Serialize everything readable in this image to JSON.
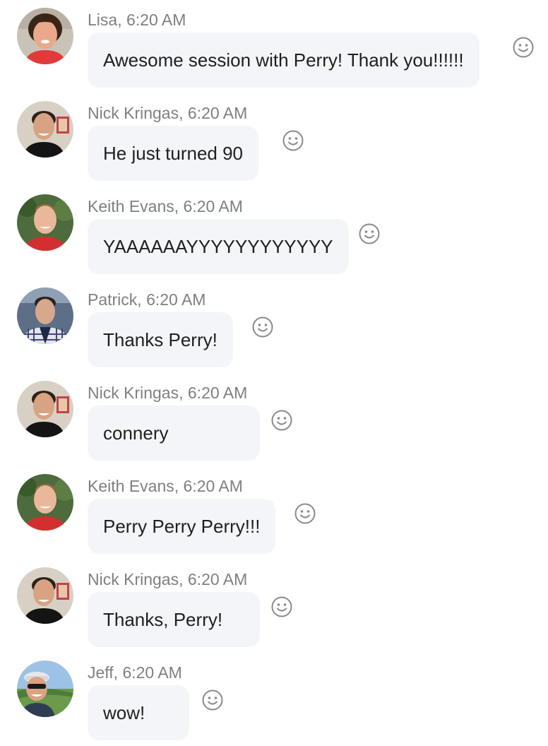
{
  "messages": [
    {
      "author": "Lisa",
      "time": "6:20 AM",
      "text": "Awesome session with Perry! Thank you!!!!!!",
      "avatar": "avatar-lisa"
    },
    {
      "author": "Nick Kringas",
      "time": "6:20 AM",
      "text": "He just turned 90",
      "avatar": "avatar-nick"
    },
    {
      "author": "Keith Evans",
      "time": "6:20 AM",
      "text": "YAAAAAAYYYYYYYYYYYY",
      "avatar": "avatar-keith"
    },
    {
      "author": "Patrick",
      "time": "6:20 AM",
      "text": "Thanks Perry!",
      "avatar": "avatar-patrick"
    },
    {
      "author": "Nick Kringas",
      "time": "6:20 AM",
      "text": "connery",
      "avatar": "avatar-nick"
    },
    {
      "author": "Keith Evans",
      "time": "6:20 AM",
      "text": "Perry Perry Perry!!!",
      "avatar": "avatar-keith"
    },
    {
      "author": "Nick Kringas",
      "time": "6:20 AM",
      "text": "Thanks, Perry!",
      "avatar": "avatar-nick"
    },
    {
      "author": "Jeff",
      "time": "6:20 AM",
      "text": "wow!",
      "avatar": "avatar-jeff"
    }
  ],
  "reaction_icon": "smiley-face-icon",
  "colors": {
    "bubble": "#f3f5f8",
    "meta_text": "#7f7f7f",
    "message_text": "#1f1f1f",
    "icon": "#8a8a8a"
  }
}
